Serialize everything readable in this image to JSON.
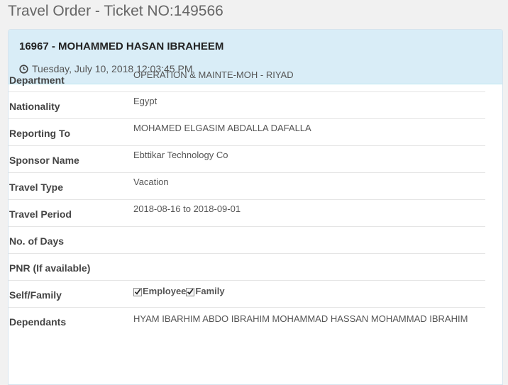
{
  "page": {
    "title": "Travel Order - Ticket NO:149566"
  },
  "header": {
    "name": "16967 - MOHAMMED HASAN IBRAHEEM",
    "date": "Tuesday, July 10, 2018 12:03:45 PM",
    "icon": "clock-icon"
  },
  "fields": {
    "department": {
      "label": "Department",
      "value": "OPERATION & MAINTE-MOH - RIYAD"
    },
    "nationality": {
      "label": "Nationality",
      "value": "Egypt"
    },
    "reporting_to": {
      "label": "Reporting To",
      "value": "MOHAMED ELGASIM ABDALLA DAFALLA"
    },
    "sponsor_name": {
      "label": "Sponsor Name",
      "value": "Ebttikar Technology Co"
    },
    "travel_type": {
      "label": "Travel Type",
      "value": "Vacation"
    },
    "travel_period": {
      "label": "Travel Period",
      "value": "2018-08-16 to 2018-09-01"
    },
    "no_of_days": {
      "label": "No. of Days",
      "value": ""
    },
    "pnr": {
      "label": "PNR (If available)",
      "value": ""
    },
    "self_family": {
      "label": "Self/Family",
      "options": [
        {
          "label": "Employee",
          "checked": true
        },
        {
          "label": "Family",
          "checked": true
        }
      ]
    },
    "dependants": {
      "label": "Dependants",
      "value": "HYAM IBARHIM ABDO IBRAHIM MOHAMMAD HASSAN MOHAMMAD IBRAHIM"
    }
  },
  "colors": {
    "heading_bg": "#d9edf7",
    "page_bg": "#f1f1f1"
  }
}
